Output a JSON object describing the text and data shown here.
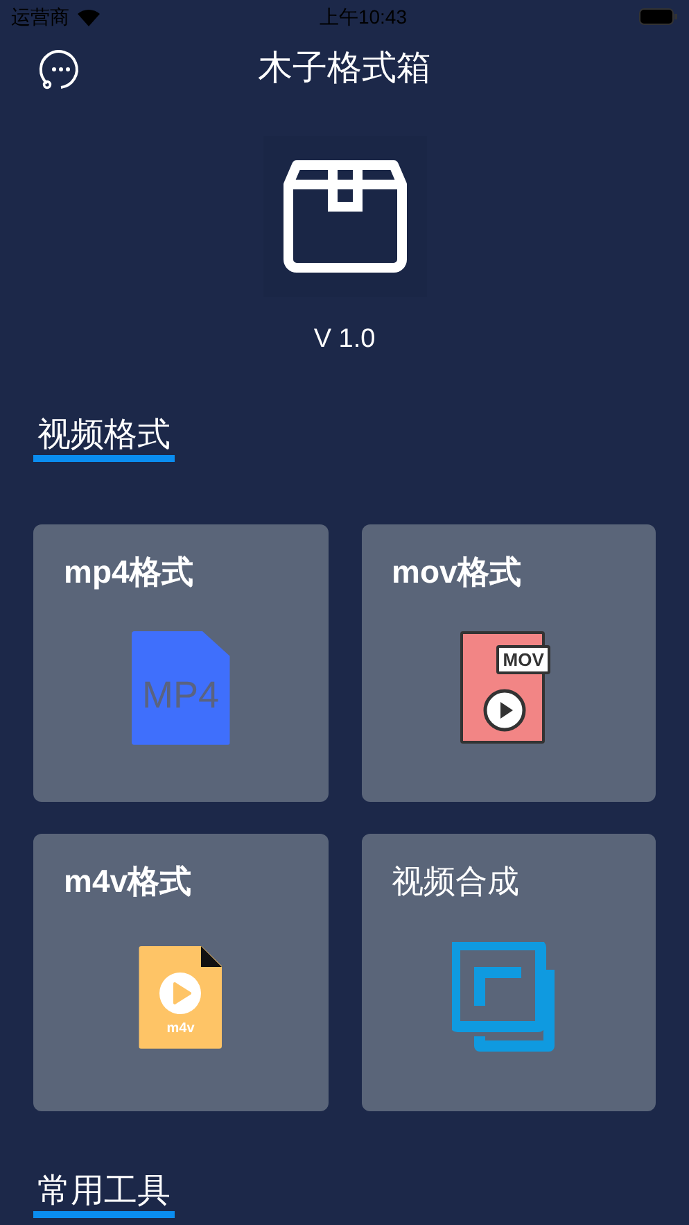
{
  "status_bar": {
    "carrier": "运营商",
    "time": "上午10:43"
  },
  "nav": {
    "title": "木子格式箱"
  },
  "app": {
    "version": "V 1.0"
  },
  "sections": [
    {
      "title": "视频格式",
      "cards": [
        {
          "label": "mp4格式",
          "kind": "mp4",
          "icon_label": "MP4"
        },
        {
          "label": "mov格式",
          "kind": "mov",
          "icon_label": "MOV"
        },
        {
          "label": "m4v格式",
          "kind": "m4v",
          "icon_label": "m4v"
        },
        {
          "label": "视频合成",
          "kind": "merge"
        }
      ]
    },
    {
      "title": "常用工具"
    }
  ]
}
